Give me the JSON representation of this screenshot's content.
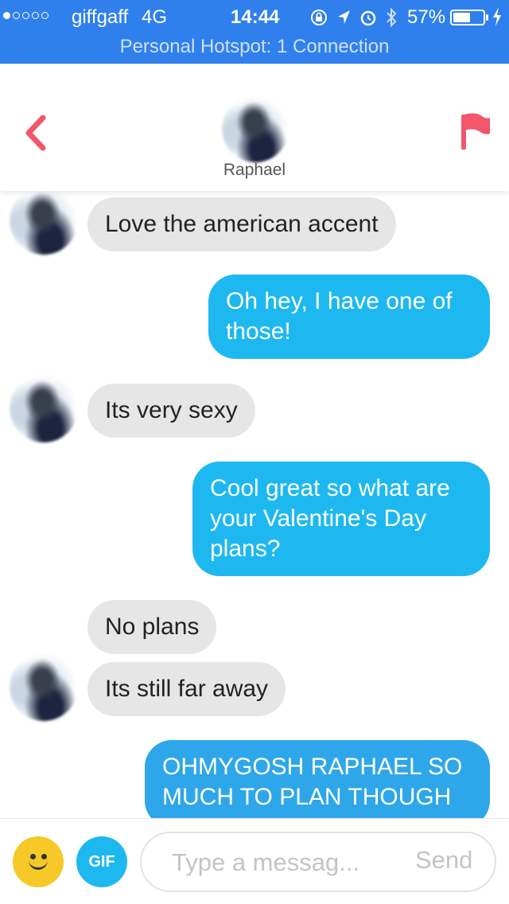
{
  "status_bar": {
    "carrier": "giffgaff",
    "network": "4G",
    "time": "14:44",
    "battery_percent": "57%",
    "battery_level": 0.57,
    "signal_bars_filled": 1,
    "signal_bars_total": 5
  },
  "hotspot_banner": "Personal Hotspot: 1 Connection",
  "header": {
    "contact_name": "Raphael",
    "back_icon": "chevron-left-icon",
    "report_icon": "flag-icon",
    "accent_color": "#f2566b"
  },
  "messages": [
    {
      "side": "incoming",
      "text": "Love the american accent"
    },
    {
      "side": "outgoing",
      "text": "Oh hey, I have one of those!"
    },
    {
      "side": "incoming",
      "text": "Its very sexy"
    },
    {
      "side": "outgoing",
      "text": "Cool great so what are your Valentine's Day plans?"
    },
    {
      "side": "incoming",
      "text": "No plans"
    },
    {
      "side": "incoming",
      "text": "Its still far away"
    },
    {
      "side": "outgoing",
      "text": "OHMYGOSH RAPHAEL SO MUCH TO PLAN THOUGH"
    }
  ],
  "composer": {
    "emoji_icon": "smiley-icon",
    "gif_label": "GIF",
    "placeholder": "Type a messag...",
    "value": "",
    "send_label": "Send"
  },
  "colors": {
    "status_bar": "#2f80ed",
    "outgoing_bubble": "#1eb8f0",
    "incoming_bubble": "#e6e6e6"
  }
}
